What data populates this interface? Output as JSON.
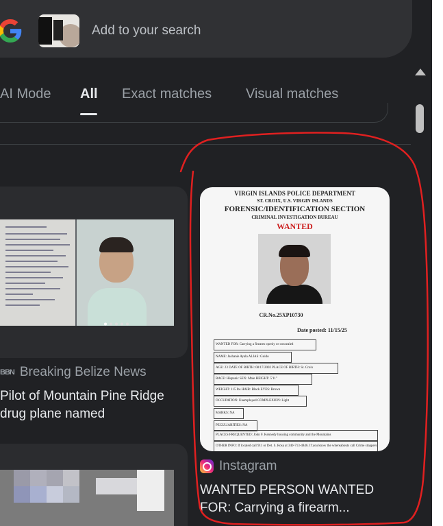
{
  "search": {
    "placeholder": "Add to your search"
  },
  "tabs": [
    {
      "label": "AI Mode"
    },
    {
      "label": "All"
    },
    {
      "label": "Exact matches"
    },
    {
      "label": "Visual matches"
    }
  ],
  "results": {
    "belize": {
      "source": "Breaking Belize News",
      "source_badge": "BBN",
      "title_line1": "Pilot of Mountain Pine Ridge",
      "title_line2": "drug plane named"
    },
    "wanted": {
      "source": "Instagram",
      "title_line1": "WANTED PERSON WANTED",
      "title_line2": "FOR: Carrying a firearm...",
      "poster": {
        "dept": "VIRGIN ISLANDS POLICE DEPARTMENT",
        "location": "ST. CROIX, U.S. VIRGIN ISLANDS",
        "section": "FORENSIC/IDENTIFICATION SECTION",
        "bureau": "CRIMINAL INVESTIGATION BUREAU",
        "wanted": "WANTED",
        "case": "CR.No.25XP10730",
        "date_posted": "Date posted: 11/15/25",
        "fields": [
          "WANTED FOR: Carrying a firearm openly or concealed",
          "NAME: Jashanie Ayala ALIAS: Guido",
          "AGE: 23 DATE OF BIRTH: 08/17/2002 PLACE OF BIRTH: St. Croix",
          "RACE: Hispanic  SEX: Male  HEIGHT: 5'11\"",
          "WEIGHT: 115 lbs HAIR: Black EYES: Brown",
          "OCCUPATION: Unemployed COMPLEXION: Light",
          "MARKS: NA",
          "PECULIARITIES: NA",
          "PLACES FREQUENTED: John F. Kennedy housing community and the Mountains",
          "OTHER INFO: If located call 911 or Det. S. Rosa at 340-713-4846. If you know the whereabouts call Crime stoppers at 1-800-222-TIPS (8477)"
        ]
      }
    }
  },
  "colors": {
    "background": "#202124",
    "searchbar": "#303134",
    "annotation": "#e02020"
  }
}
